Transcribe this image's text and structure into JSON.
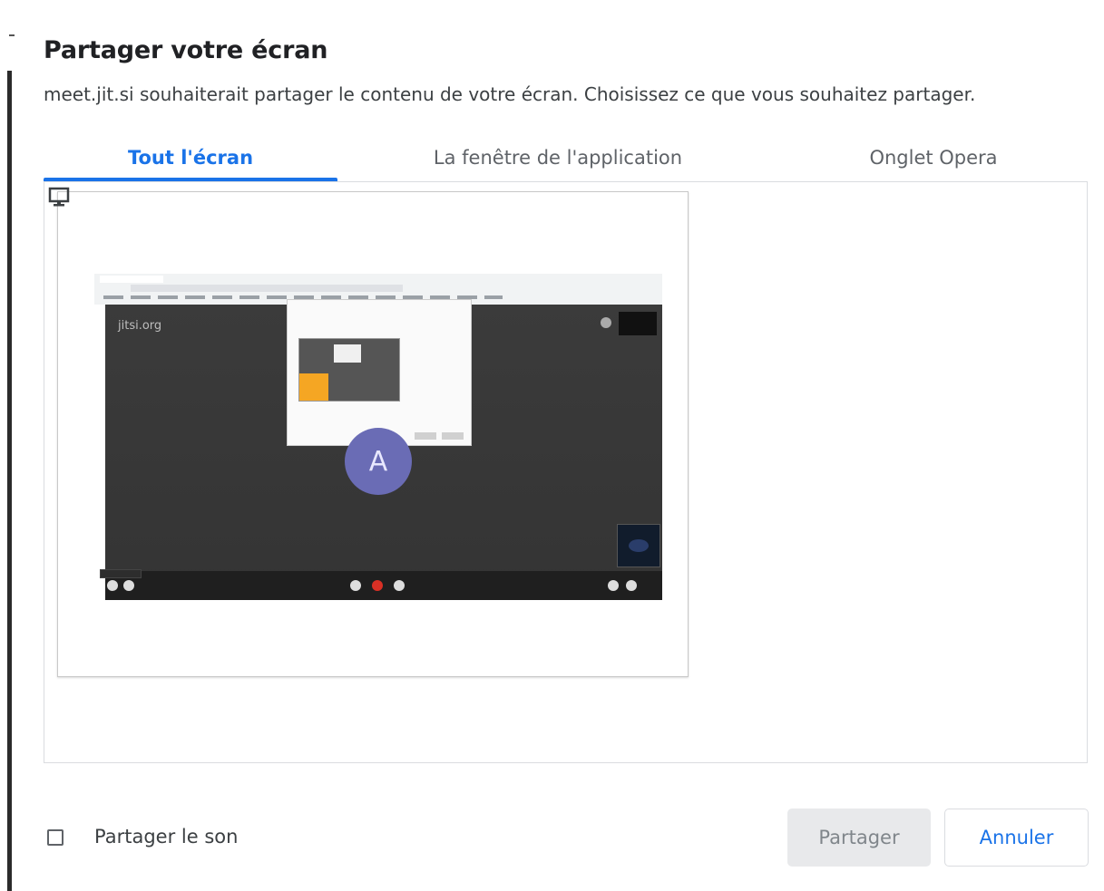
{
  "dialog": {
    "title": "Partager votre écran",
    "subtitle": "meet.jit.si souhaiterait partager le contenu de votre écran. Choisissez ce que vous souhaitez partager."
  },
  "tabs": [
    {
      "label": "Tout l'écran",
      "active": true
    },
    {
      "label": "La fenêtre de l'application",
      "active": false
    },
    {
      "label": "Onglet Opera",
      "active": false
    }
  ],
  "preview": {
    "icon": "monitor-icon",
    "watermark": "jitsi.org",
    "avatar_initial": "A"
  },
  "footer": {
    "audio_checkbox_label": "Partager le son",
    "audio_checked": false,
    "share_label": "Partager",
    "cancel_label": "Annuler"
  },
  "colors": {
    "accent": "#1a73e8",
    "avatar": "#6a6cb5",
    "hangup": "#d93025"
  }
}
